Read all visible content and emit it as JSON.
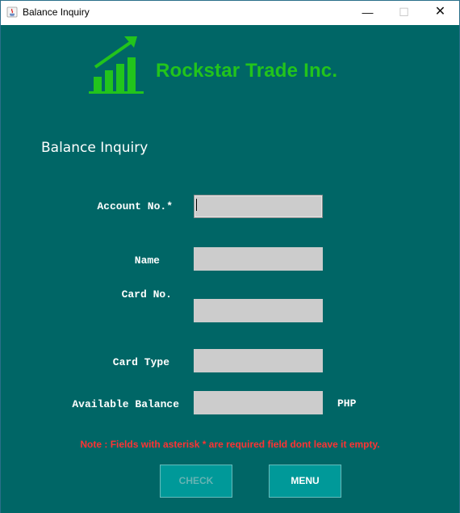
{
  "window": {
    "title": "Balance Inquiry",
    "minimize_glyph": "—",
    "maximize_glyph": "☐",
    "close_glyph": "✕"
  },
  "header": {
    "company_name": "Rockstar Trade Inc.",
    "logo_icon": "bar-chart-growth-icon",
    "brand_color": "#22c41c"
  },
  "form": {
    "title": "Balance Inquiry",
    "fields": {
      "account_no": {
        "label": "Account No.*",
        "value": ""
      },
      "name": {
        "label": "Name",
        "value": ""
      },
      "card_no": {
        "label": "Card No.",
        "value": ""
      },
      "card_type": {
        "label": "Card Type",
        "value": ""
      },
      "available_balance": {
        "label": "Available Balance",
        "value": "",
        "unit": "PHP"
      }
    },
    "note": "Note : Fields with asterisk * are required field dont leave it empty."
  },
  "buttons": {
    "check": "CHECK",
    "menu": "MENU"
  },
  "colors": {
    "background": "#006666",
    "field": "#cccccc",
    "note": "#ff3333",
    "button": "#009999"
  }
}
